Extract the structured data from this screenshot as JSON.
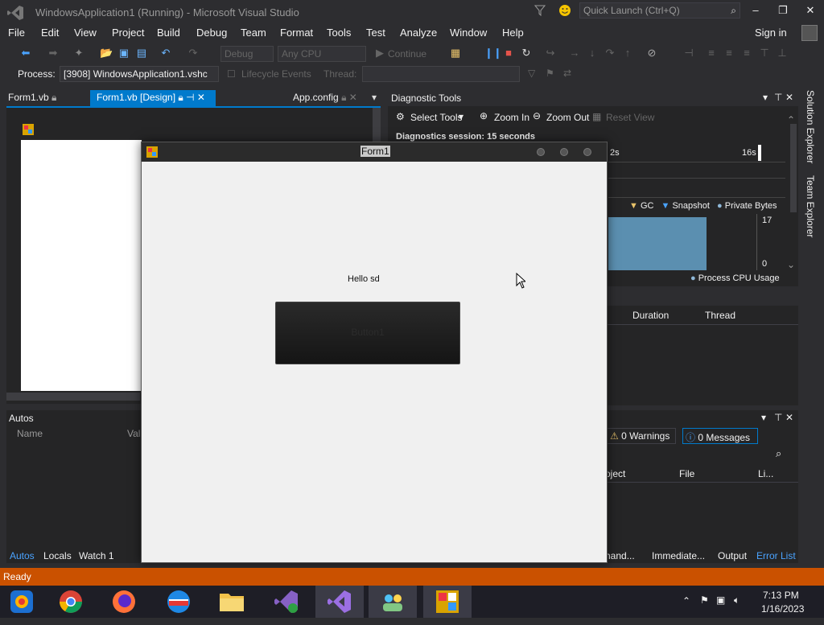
{
  "window": {
    "title": "WindowsApplication1 (Running) - Microsoft Visual Studio",
    "quick_launch_placeholder": "Quick Launch (Ctrl+Q)",
    "sign_in": "Sign in"
  },
  "menu": [
    "File",
    "Edit",
    "View",
    "Project",
    "Build",
    "Debug",
    "Team",
    "Format",
    "Tools",
    "Test",
    "Analyze",
    "Window",
    "Help"
  ],
  "toolbar": {
    "config": "Debug",
    "platform": "Any CPU",
    "continue": "Continue"
  },
  "process_bar": {
    "label": "Process:",
    "process": "[3908] WindowsApplication1.vshc",
    "lifecycle": "Lifecycle Events",
    "thread_label": "Thread:"
  },
  "doc_tabs": [
    {
      "label": "Form1.vb"
    },
    {
      "label": "Form1.vb [Design]"
    },
    {
      "label": "App.config"
    }
  ],
  "diagnostic_tools": {
    "title": "Diagnostic Tools",
    "select_tools": "Select Tools",
    "zoom_in": "Zoom In",
    "zoom_out": "Zoom Out",
    "reset_view": "Reset View",
    "session": "Diagnostics session: 15 seconds",
    "timeline_start": "2s",
    "timeline_end": "16s",
    "legend": [
      "GC",
      "Snapshot",
      "Private Bytes"
    ],
    "y_max": "17",
    "y_min": "0",
    "cpu_label": "Process CPU Usage",
    "columns": [
      "Duration",
      "Thread"
    ]
  },
  "side_panels": [
    "Solution Explorer",
    "Team Explorer"
  ],
  "autos": {
    "title": "Autos",
    "col_name": "Name",
    "col_value": "Val",
    "tabs": [
      "Autos",
      "Locals",
      "Watch 1"
    ]
  },
  "error_list": {
    "warnings": "0 Warnings",
    "messages": "0 Messages",
    "columns": [
      "oject",
      "File",
      "Li..."
    ],
    "tabs": [
      "hand...",
      "Immediate...",
      "Output",
      "Error List"
    ]
  },
  "form1": {
    "title": "Form1",
    "label": "Hello sd",
    "button_text": "Button1"
  },
  "status": {
    "text": "Ready"
  },
  "taskbar": {
    "time": "7:13 PM",
    "date": "1/16/2023"
  },
  "colors": {
    "accent": "#007acc",
    "status_bar": "#ca5100",
    "chart_fill": "#5b8fb0"
  }
}
